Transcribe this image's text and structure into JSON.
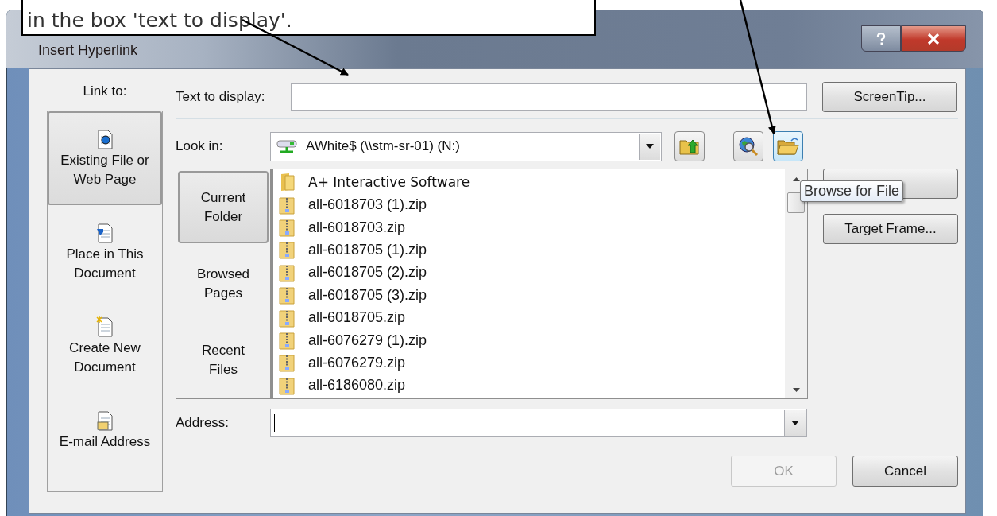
{
  "annotation": {
    "text": "in the box 'text to display'."
  },
  "window": {
    "title": "Insert Hyperlink"
  },
  "link_to": {
    "label": "Link to:",
    "items": [
      {
        "label": "Existing File or Web Page",
        "kind": "file",
        "selected": true
      },
      {
        "label": "Place in This Document",
        "kind": "place",
        "selected": false
      },
      {
        "label": "Create New Document",
        "kind": "new",
        "selected": false
      },
      {
        "label": "E-mail Address",
        "kind": "mail",
        "selected": false
      }
    ]
  },
  "text_to_display": {
    "label": "Text to display:"
  },
  "screentip_button": "ScreenTip...",
  "look_in": {
    "label": "Look in:",
    "value": "AWhite$ (\\\\stm-sr-01) (N:)"
  },
  "toolbar": [
    {
      "kind": "up",
      "hovered": false
    },
    {
      "kind": "web",
      "hovered": false
    },
    {
      "kind": "browse",
      "hovered": true
    }
  ],
  "nav": [
    {
      "label": "Current Folder",
      "selected": true
    },
    {
      "label": "Browsed Pages",
      "selected": false
    },
    {
      "label": "Recent Files",
      "selected": false
    }
  ],
  "files": [
    {
      "name": "A+ Interactive Software",
      "kind": "folder"
    },
    {
      "name": "all-6018703 (1).zip",
      "kind": "zip"
    },
    {
      "name": "all-6018703.zip",
      "kind": "zip"
    },
    {
      "name": "all-6018705 (1).zip",
      "kind": "zip"
    },
    {
      "name": "all-6018705 (2).zip",
      "kind": "zip"
    },
    {
      "name": "all-6018705 (3).zip",
      "kind": "zip"
    },
    {
      "name": "all-6018705.zip",
      "kind": "zip"
    },
    {
      "name": "all-6076279 (1).zip",
      "kind": "zip"
    },
    {
      "name": "all-6076279.zip",
      "kind": "zip"
    },
    {
      "name": "all-6186080.zip",
      "kind": "zip"
    }
  ],
  "tooltip": "Browse for File",
  "side_buttons": [
    {
      "kind": "covered"
    },
    {
      "kind": "labeled",
      "label": "Target Frame..."
    }
  ],
  "address": {
    "label": "Address:"
  },
  "buttons": [
    {
      "label": "OK",
      "disabled": true
    },
    {
      "label": "Cancel",
      "disabled": false
    }
  ]
}
